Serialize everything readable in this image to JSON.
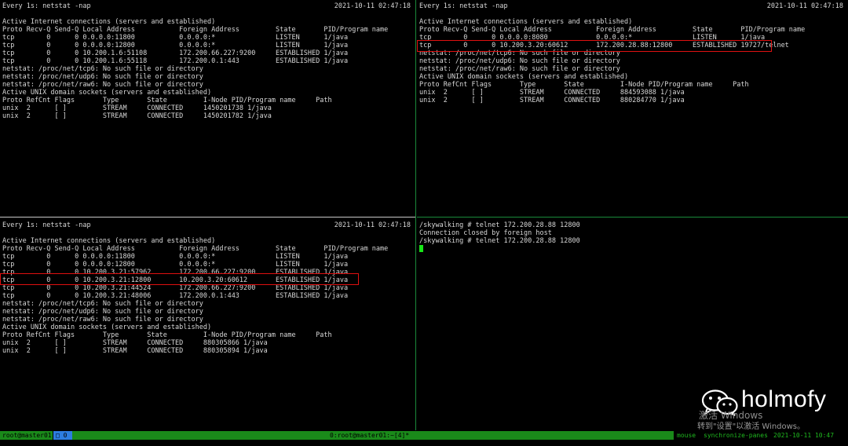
{
  "pane_top_left": {
    "header_left": "Every 1s: netstat -nap",
    "header_right": "2021-10-11 02:47:18",
    "lines": [
      "Active Internet connections (servers and established)",
      "Proto Recv-Q Send-Q Local Address           Foreign Address         State       PID/Program name",
      "tcp        0      0 0.0.0.0:11800           0.0.0.0:*               LISTEN      1/java",
      "tcp        0      0 0.0.0.0:12800           0.0.0.0:*               LISTEN      1/java",
      "tcp        0      0 10.200.1.6:51108        172.200.66.227:9200     ESTABLISHED 1/java",
      "tcp        0      0 10.200.1.6:55118        172.200.0.1:443         ESTABLISHED 1/java",
      "netstat: /proc/net/tcp6: No such file or directory",
      "netstat: /proc/net/udp6: No such file or directory",
      "netstat: /proc/net/raw6: No such file or directory",
      "Active UNIX domain sockets (servers and established)",
      "Proto RefCnt Flags       Type       State         I-Node PID/Program name     Path",
      "unix  2      [ ]         STREAM     CONNECTED     1450201738 1/java",
      "unix  2      [ ]         STREAM     CONNECTED     1450201782 1/java"
    ]
  },
  "pane_top_right": {
    "header_left": "Every 1s: netstat -nap",
    "header_right": "2021-10-11 02:47:18",
    "lines": [
      "Active Internet connections (servers and established)",
      "Proto Recv-Q Send-Q Local Address           Foreign Address         State       PID/Program name",
      "tcp        0      0 0.0.0.0:8080            0.0.0.0:*               LISTEN      1/java",
      "tcp        0      0 10.200.3.20:60612       172.200.28.88:12800     ESTABLISHED 19727/telnet",
      "netstat: /proc/net/tcp6: No such file or directory",
      "netstat: /proc/net/udp6: No such file or directory",
      "netstat: /proc/net/raw6: No such file or directory",
      "Active UNIX domain sockets (servers and established)",
      "Proto RefCnt Flags       Type       State         I-Node PID/Program name     Path",
      "unix  2      [ ]         STREAM     CONNECTED     884593088 1/java",
      "unix  2      [ ]         STREAM     CONNECTED     880284770 1/java"
    ]
  },
  "pane_bottom_left": {
    "header_left": "Every 1s: netstat -nap",
    "header_right": "2021-10-11 02:47:18",
    "lines": [
      "Active Internet connections (servers and established)",
      "Proto Recv-Q Send-Q Local Address           Foreign Address         State       PID/Program name",
      "tcp        0      0 0.0.0.0:11800           0.0.0.0:*               LISTEN      1/java",
      "tcp        0      0 0.0.0.0:12800           0.0.0.0:*               LISTEN      1/java",
      "tcp        0      0 10.200.3.21:57962       172.200.66.227:9200     ESTABLISHED 1/java",
      "tcp        0      0 10.200.3.21:12800       10.200.3.20:60612       ESTABLISHED 1/java",
      "tcp        0      0 10.200.3.21:44524       172.200.66.227:9200     ESTABLISHED 1/java",
      "tcp        0      0 10.200.3.21:48006       172.200.0.1:443         ESTABLISHED 1/java",
      "netstat: /proc/net/tcp6: No such file or directory",
      "netstat: /proc/net/udp6: No such file or directory",
      "netstat: /proc/net/raw6: No such file or directory",
      "Active UNIX domain sockets (servers and established)",
      "Proto RefCnt Flags       Type       State         I-Node PID/Program name     Path",
      "unix  2      [ ]         STREAM     CONNECTED     880305866 1/java",
      "unix  2      [ ]         STREAM     CONNECTED     880305894 1/java"
    ]
  },
  "pane_bottom_right": {
    "lines": [
      "/skywalking # telnet 172.200.28.88 12800",
      "Connection closed by foreign host",
      "/skywalking # telnet 172.200.28.88 12800"
    ]
  },
  "statusbar": {
    "session": "root@master01",
    "window_tab": "□ 0",
    "center": "0:root@master01:~[4]*",
    "mode": "mouse",
    "sync": "synchronize-panes",
    "datetime": "2021-10-11 10:47"
  },
  "watermark": {
    "account": "holmofy",
    "activate_line1": "激活 Windows",
    "activate_line2": "转到\"设置\"以激活 Windows。"
  },
  "colors": {
    "highlight_box": "#e01010",
    "cursor": "#17e617",
    "status_green": "#1a8a1a",
    "status_blue": "#2d7de0"
  },
  "icons": {
    "wechat": "wechat-icon"
  }
}
